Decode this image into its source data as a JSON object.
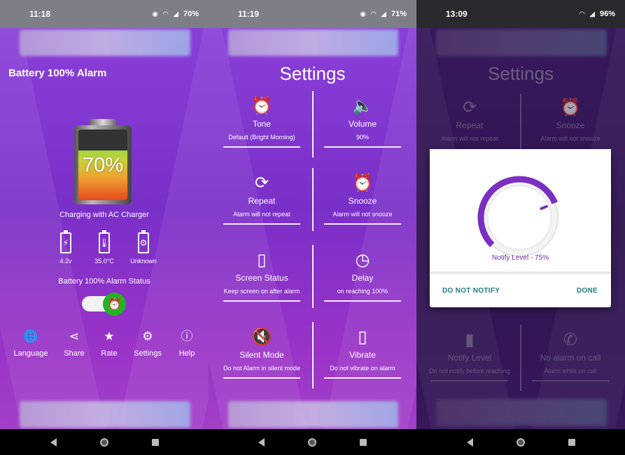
{
  "panel1": {
    "status": {
      "time": "11:18",
      "battery": "70%"
    },
    "app_title": "Battery 100% Alarm",
    "battery_percent": "70%",
    "battery_level": 0.7,
    "charging_text": "Charging with AC Charger",
    "stats": [
      {
        "value": "4.2v",
        "icon": "bolt-battery-icon"
      },
      {
        "value": "35.0°C",
        "icon": "thermometer-battery-icon"
      },
      {
        "value": "Unknown",
        "icon": "gear-battery-icon"
      }
    ],
    "alarm_status_label": "Battery 100% Alarm Status",
    "alarm_enabled": true,
    "bottom_nav": [
      {
        "label": "Language",
        "icon": "globe-icon"
      },
      {
        "label": "Share",
        "icon": "share-icon"
      },
      {
        "label": "Rate",
        "icon": "star-icon"
      },
      {
        "label": "Settings",
        "icon": "gear-icon"
      },
      {
        "label": "Help",
        "icon": "info-icon"
      }
    ]
  },
  "panel2": {
    "status": {
      "time": "11:19",
      "battery": "71%"
    },
    "title": "Settings",
    "items": [
      {
        "title": "Tone",
        "subtitle": "Default (Bright Morning)",
        "icon": "alarm-clock-music-icon"
      },
      {
        "title": "Volume",
        "subtitle": "90%",
        "icon": "speaker-icon"
      },
      {
        "title": "Repeat",
        "subtitle": "Alarm will not repeat",
        "icon": "repeat-icon"
      },
      {
        "title": "Snooze",
        "subtitle": "Alarm will not snooze",
        "icon": "snooze-clock-icon"
      },
      {
        "title": "Screen Status",
        "subtitle": "Keep screen on after alarm",
        "icon": "phone-screen-icon"
      },
      {
        "title": "Delay",
        "subtitle": "on reaching 100%",
        "icon": "delay-clock-icon"
      },
      {
        "title": "Silent Mode",
        "subtitle": "Do not Alarm in silent mode",
        "icon": "muted-speaker-icon"
      },
      {
        "title": "Vibrate",
        "subtitle": "Do not vibrate on alarm",
        "icon": "vibrate-phone-icon"
      }
    ]
  },
  "panel3": {
    "status": {
      "time": "13:09",
      "battery": "96%"
    },
    "title": "Settings",
    "items_top": [
      {
        "title": "Repeat",
        "subtitle": "Alarm will not repeat",
        "icon": "repeat-icon"
      },
      {
        "title": "Snooze",
        "subtitle": "Alarm will not snooze",
        "icon": "snooze-clock-icon"
      }
    ],
    "items_bottom": [
      {
        "title": "Notify Level",
        "subtitle": "Do not notify before reaching",
        "icon": "percent-battery-icon"
      },
      {
        "title": "No alarm on call",
        "subtitle": "Alarm while on call",
        "icon": "no-call-icon"
      }
    ],
    "dialog": {
      "label": "Notify Level - 75%",
      "level": 0.75,
      "negative": "DO NOT NOTIFY",
      "positive": "DONE",
      "accent": "#7a2fc1"
    }
  }
}
